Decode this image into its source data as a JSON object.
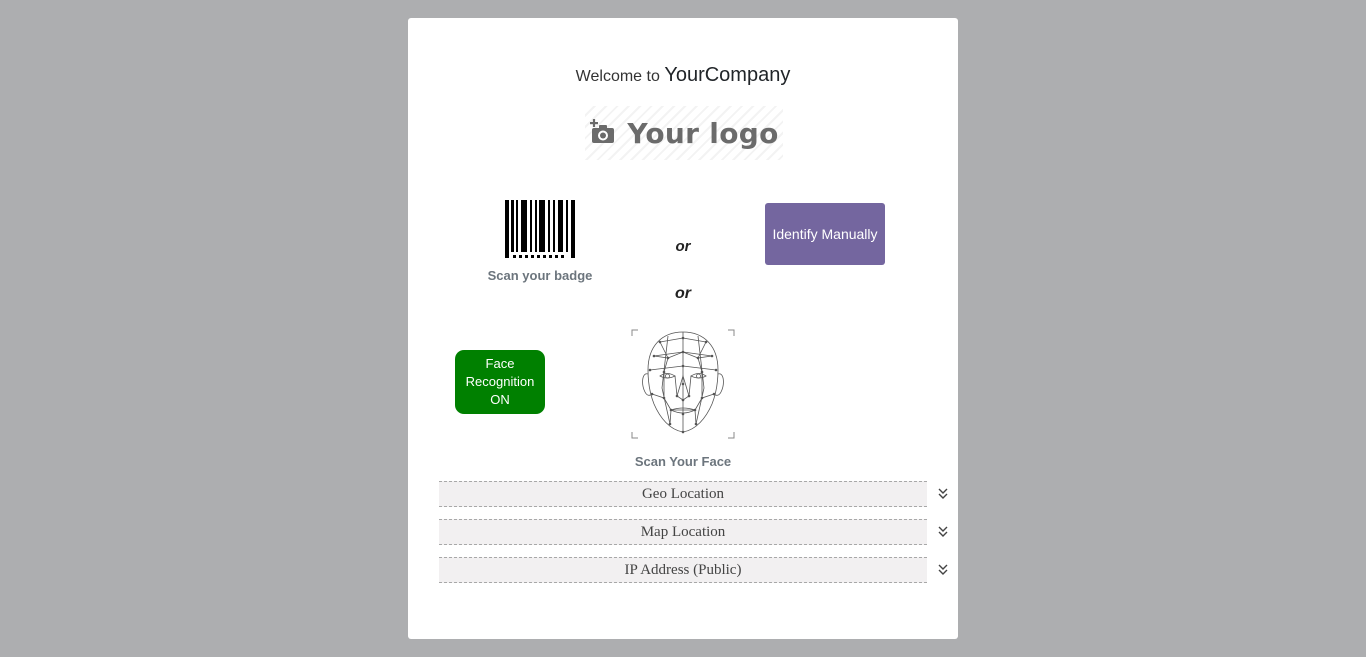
{
  "welcome": {
    "prefix": "Welcome to",
    "company": "YourCompany"
  },
  "logo": {
    "text": "Your logo",
    "icon": "camera-plus-icon"
  },
  "badge": {
    "icon": "barcode-icon",
    "label": "Scan your badge"
  },
  "separators": {
    "or_1": "or",
    "or_2": "or"
  },
  "identify_button": {
    "label": "Identify Manually",
    "color": "#74669f"
  },
  "face_recognition": {
    "label": "Face Recognition ON",
    "color": "#008000"
  },
  "face_scan": {
    "icon": "face-mesh-icon",
    "label": "Scan Your Face"
  },
  "sections": [
    {
      "title": "Geo Location",
      "icon": "chevron-double-down-icon"
    },
    {
      "title": "Map Location",
      "icon": "chevron-double-down-icon"
    },
    {
      "title": "IP Address (Public)",
      "icon": "chevron-double-down-icon"
    }
  ]
}
